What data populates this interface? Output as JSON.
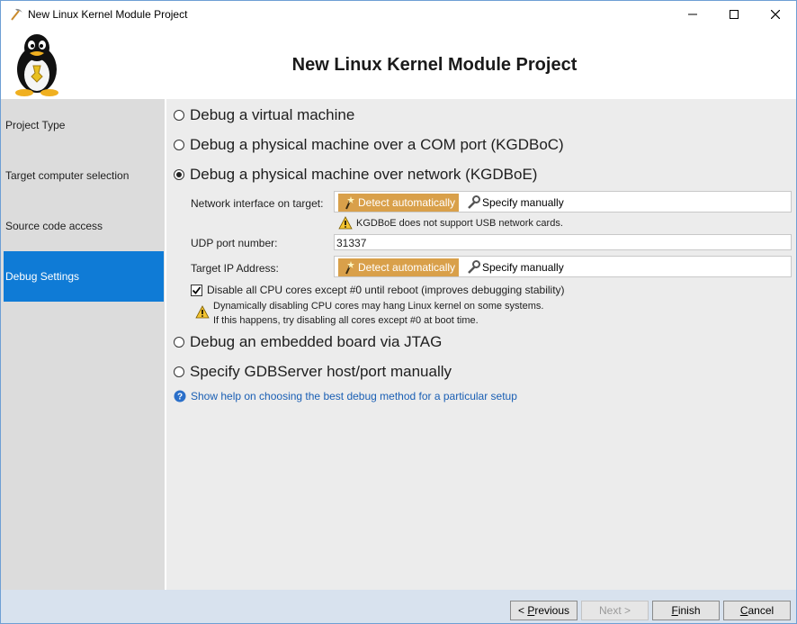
{
  "window": {
    "title": "New Linux Kernel Module Project"
  },
  "header": {
    "title": "New Linux Kernel Module Project",
    "logo_icon": "tux-penguin-icon"
  },
  "sidebar": {
    "items": [
      {
        "label": "Project Type",
        "active": false
      },
      {
        "label": "Target computer selection",
        "active": false
      },
      {
        "label": "Source code access",
        "active": false
      },
      {
        "label": "Debug Settings",
        "active": true
      }
    ],
    "active_color": "#0f7bd6"
  },
  "options": [
    {
      "label": "Debug a virtual machine",
      "checked": false
    },
    {
      "label": "Debug a physical machine over a COM port (KGDBoC)",
      "checked": false
    },
    {
      "label": "Debug a physical machine over network (KGDBoE)",
      "checked": true
    },
    {
      "label": "Debug an embedded board via JTAG",
      "checked": false
    },
    {
      "label": "Specify GDBServer host/port manually",
      "checked": false
    }
  ],
  "network_interface": {
    "label": "Network interface on target:",
    "detect_label": "Detect automatically",
    "manual_label": "Specify manually",
    "warning": "KGDBoE does not support USB network cards."
  },
  "udp_port": {
    "label": "UDP port number:",
    "value": "31337"
  },
  "target_ip": {
    "label": "Target IP Address:",
    "detect_label": "Detect automatically",
    "manual_label": "Specify manually"
  },
  "cpu_cores": {
    "label": "Disable all CPU cores except #0 until reboot (improves debugging stability)",
    "checked": true,
    "warning_line1": "Dynamically disabling CPU cores may hang Linux kernel on some systems.",
    "warning_line2": "If this happens, try disabling all cores except #0 at boot time."
  },
  "help_link": "Show help on choosing the best debug method for a particular setup",
  "footer": {
    "previous_prefix": "< ",
    "previous_label": "Previous",
    "previous_accel": "P",
    "previous_rest": "revious",
    "next_label": "Next >",
    "finish_label": "Finish",
    "finish_accel": "F",
    "finish_rest": "inish",
    "cancel_label": "Cancel",
    "cancel_accel": "C",
    "cancel_rest": "ancel"
  },
  "colors": {
    "accent_detect": "#d9a04a",
    "link": "#1a5fb4",
    "footer_bg": "#d8e2ee"
  }
}
